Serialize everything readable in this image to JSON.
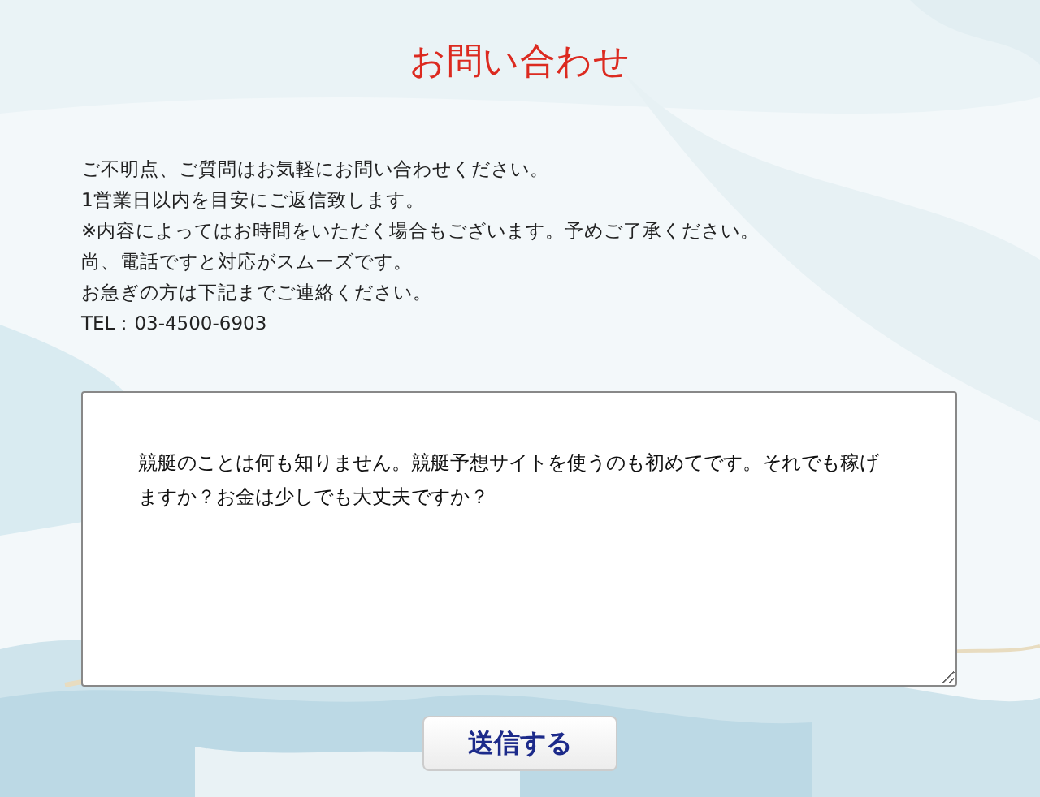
{
  "page": {
    "title": "お問い合わせ"
  },
  "intro_lines": [
    "ご不明点、ご質問はお気軽にお問い合わせください。",
    "1営業日以内を目安にご返信致します。",
    "※内容によってはお時間をいただく場合もございます。予めご了承ください。",
    "尚、電話ですと対応がスムーズです。",
    "お急ぎの方は下記までご連絡ください。",
    "TEL：03-4500-6903"
  ],
  "message": {
    "value": "競艇のことは何も知りません。競艇予想サイトを使うのも初めてです。それでも稼げますか？お金は少しでも大丈夫ですか？"
  },
  "submit_button": {
    "label": "送信する"
  }
}
